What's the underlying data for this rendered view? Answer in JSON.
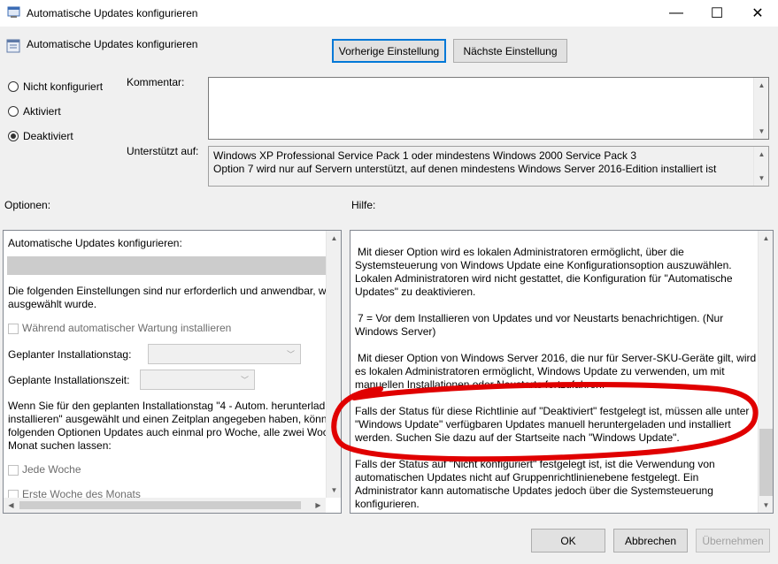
{
  "window": {
    "title": "Automatische Updates konfigurieren",
    "minimize": "—",
    "maximize": "☐",
    "close": "✕"
  },
  "header": {
    "policy_title": "Automatische Updates konfigurieren",
    "prev_button": "Vorherige Einstellung",
    "next_button": "Nächste Einstellung"
  },
  "state": {
    "options": [
      {
        "label": "Nicht konfiguriert",
        "selected": false
      },
      {
        "label": "Aktiviert",
        "selected": false
      },
      {
        "label": "Deaktiviert",
        "selected": true
      }
    ]
  },
  "comment": {
    "label": "Kommentar:",
    "value": ""
  },
  "supported": {
    "label": "Unterstützt auf:",
    "lines": [
      "Windows XP Professional Service Pack 1 oder mindestens Windows 2000 Service Pack 3",
      "Option 7 wird nur auf Servern unterstützt, auf denen mindestens Windows Server 2016-Edition installiert ist"
    ]
  },
  "options_section": {
    "label": "Optionen:",
    "heading": "Automatische Updates konfigurieren:",
    "desc_lines": [
      "Die folgenden Einstellungen sind nur erforderlich und anwendbar, w",
      "ausgewählt wurde."
    ],
    "checkbox_maintenance": "Während automatischer Wartung installieren",
    "day_label": "Geplanter Installationstag:",
    "time_label": "Geplante Installationszeit:",
    "para_lines": [
      "Wenn Sie für den geplanten Installationstag \"4 - Autom. herunterlad",
      "installieren\" ausgewählt und einen Zeitplan angegeben haben, könn",
      "folgenden Optionen Updates auch einmal pro Woche, alle zwei Woc",
      "Monat suchen lassen:"
    ],
    "checkbox_every_week": "Jede Woche",
    "checkbox_first_week": "Erste Woche des Monats"
  },
  "help_section": {
    "label": "Hilfe:",
    "paragraphs": [
      [
        "Mit dieser Option wird es lokalen Administratoren ermöglicht, über die",
        "Systemsteuerung von Windows Update eine Konfigurationsoption auszuwählen.",
        "Lokalen Administratoren wird nicht gestattet, die Konfiguration für \"Automatische",
        "Updates\" zu deaktivieren."
      ],
      [
        "7 = Vor dem Installieren von Updates und vor Neustarts benachrichtigen. (Nur",
        "Windows Server)"
      ],
      [
        "Mit dieser Option von Windows Server 2016, die nur für Server-SKU-Geräte gilt, wird",
        "es lokalen Administratoren ermöglicht, Windows Update zu verwenden, um mit",
        "manuellen Installationen oder Neustarts fortzufahren."
      ],
      [
        "Falls der Status für diese Richtlinie auf \"Deaktiviert\" festgelegt ist, müssen alle unter",
        "\"Windows Update\" verfügbaren Updates manuell heruntergeladen und installiert",
        "werden. Suchen Sie dazu auf der Startseite nach \"Windows Update\"."
      ],
      [
        "Falls der Status auf \"Nicht konfiguriert\" festgelegt ist, ist die Verwendung von",
        "automatischen Updates nicht auf Gruppenrichtlinienebene festgelegt. Ein",
        "Administrator kann automatische Updates jedoch über die Systemsteuerung",
        "konfigurieren."
      ]
    ]
  },
  "footer": {
    "ok": "OK",
    "cancel": "Abbrechen",
    "apply": "Übernehmen"
  },
  "colors": {
    "highlight_ellipse": "#e00000",
    "accent": "#0078d7"
  }
}
